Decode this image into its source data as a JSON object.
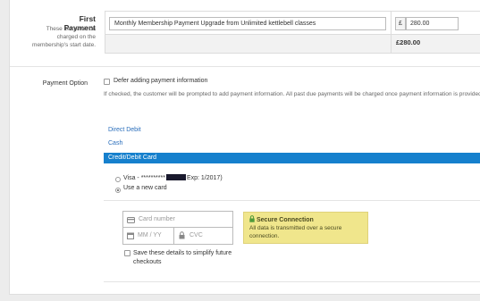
{
  "first_payment": {
    "title": "First Payment",
    "subtitle": "These items will be charged on the membership's start date.",
    "description_value": "Monthly Membership Payment Upgrade from Unlimited kettlebell classes",
    "currency_symbol": "£",
    "amount_value": "280.00",
    "total": "£280.00"
  },
  "payment_option": {
    "label": "Payment Option",
    "defer_label": "Defer adding payment information",
    "defer_help": "If checked, the customer will be prompted to add payment information. All past due payments will be charged once payment information is provided."
  },
  "methods": {
    "direct_debit": "Direct Debit",
    "cash": "Cash",
    "card": "Credit/Debit Card",
    "accent_color": "#1680cd"
  },
  "saved_cards": {
    "visa_prefix": "Visa - **********",
    "visa_suffix": "Exp: 1/2017)",
    "use_new": "Use a new card"
  },
  "card_form": {
    "card_number_placeholder": "Card number",
    "expiry_placeholder": "MM / YY",
    "cvc_placeholder": "CVC",
    "card_icon": "credit-card-icon",
    "calendar_icon": "calendar-icon",
    "lock_icon": "lock-icon",
    "save_label": "Save these details to simplify future checkouts"
  },
  "secure": {
    "title": "Secure Connection",
    "text": "All data is transmitted over a secure connection.",
    "bg_color": "#f0e68c"
  }
}
